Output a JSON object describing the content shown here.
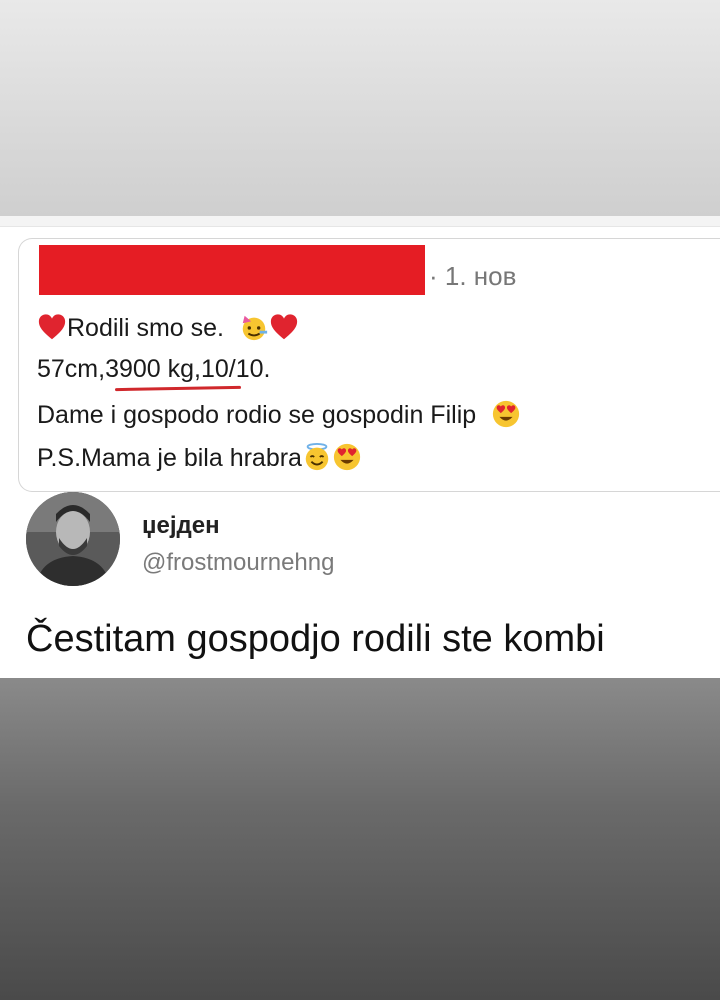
{
  "quoted_post": {
    "timestamp": "· 1. нов",
    "line1": "Rodili smo se.",
    "line2": "57cm,3900 kg,10/10.",
    "line3": "Dame i gospodo rodio se gospodin Filip",
    "line4": "P.S.Mama je bila hrabra",
    "icons": [
      "heart-icon",
      "party-face-icon",
      "heart-eyes-icon",
      "smiling-halo-icon"
    ]
  },
  "reply": {
    "display_name": "џејден",
    "handle": "@frostmournehng",
    "text": "Čestitam gospodjo rodili ste kombi"
  },
  "colors": {
    "redaction": "#e51d24",
    "underline": "#d0282c",
    "heart": "#e0242f"
  }
}
